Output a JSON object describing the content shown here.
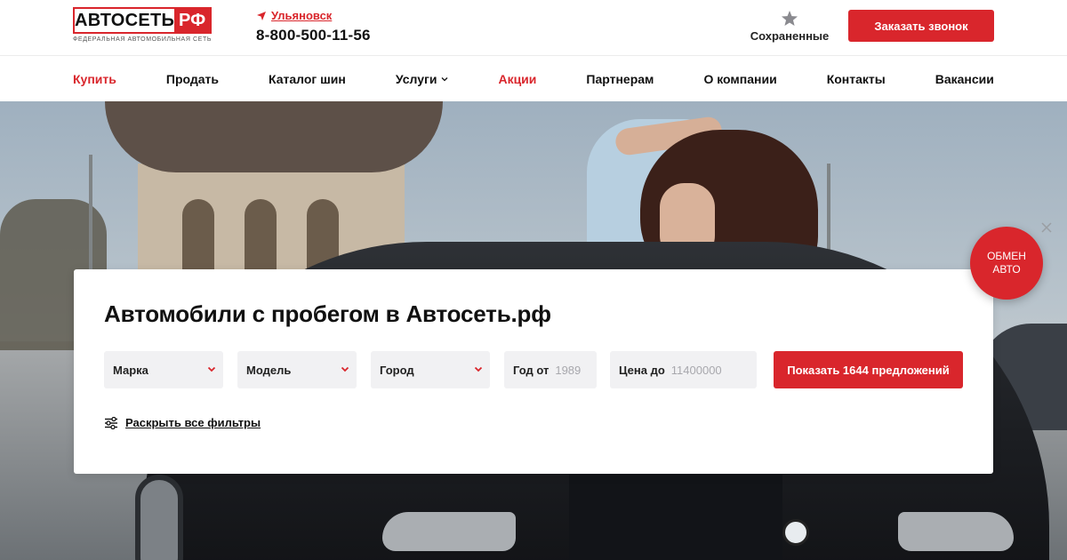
{
  "brand": {
    "logo_main": "АВТОСЕТЬ",
    "logo_rf": "РФ",
    "tagline": "ФЕДЕРАЛЬНАЯ АВТОМОБИЛЬНАЯ СЕТЬ",
    "accent_color": "#d9262c"
  },
  "header": {
    "city": "Ульяновск",
    "city_icon": "location-arrow-icon",
    "phone": "8-800-500-11-56",
    "saved_label": "Сохраненные",
    "saved_icon": "star-icon",
    "call_button": "Заказать звонок"
  },
  "nav": {
    "items": [
      {
        "label": "Купить",
        "active": true
      },
      {
        "label": "Продать"
      },
      {
        "label": "Каталог шин"
      },
      {
        "label": "Услуги",
        "has_dropdown": true
      },
      {
        "label": "Акции",
        "highlight": true
      },
      {
        "label": "Партнерам"
      },
      {
        "label": "О компании"
      },
      {
        "label": "Контакты"
      },
      {
        "label": "Вакансии"
      }
    ]
  },
  "search": {
    "title": "Автомобили с пробегом в Автосеть.рф",
    "make_label": "Марка",
    "model_label": "Модель",
    "city_label": "Город",
    "year_label": "Год от",
    "year_placeholder": "1989",
    "price_label": "Цена до",
    "price_placeholder": "11400000",
    "show_button": "Показать 1644 предложений",
    "all_filters": "Раскрыть все фильтры",
    "filters_icon": "sliders-icon"
  },
  "trade_in": {
    "line1": "ОБМЕН",
    "line2": "АВТО",
    "close_icon": "close-icon"
  }
}
